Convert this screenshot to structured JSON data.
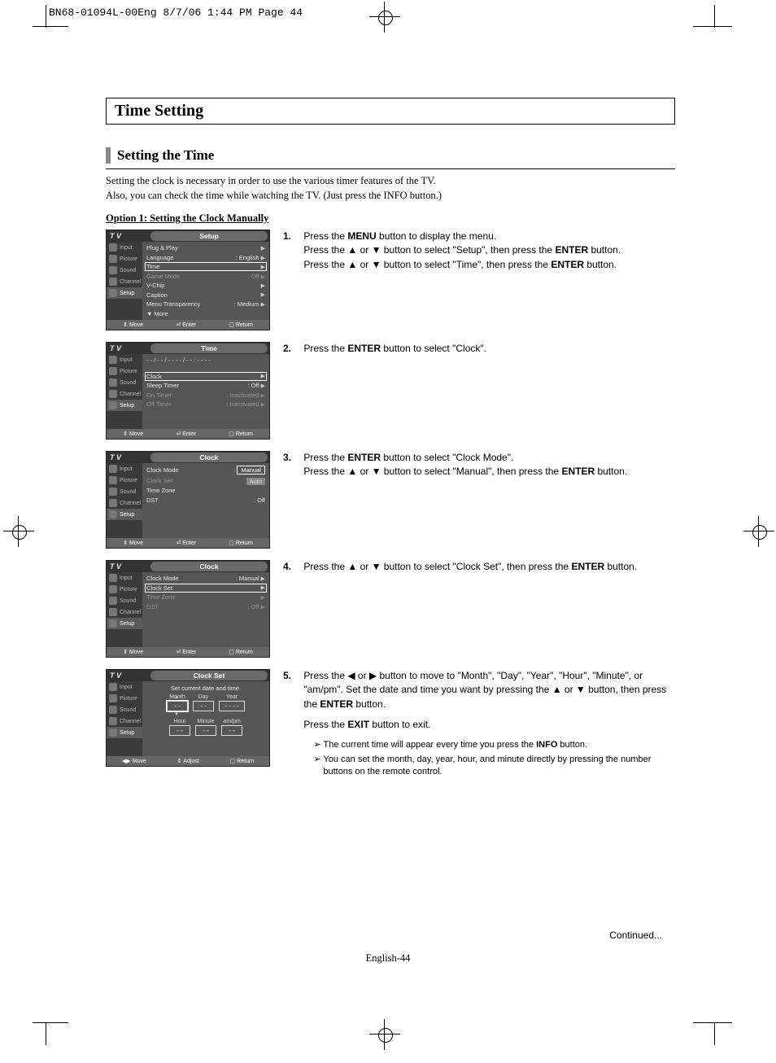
{
  "header": "BN68-01094L-00Eng  8/7/06  1:44 PM  Page 44",
  "section_title": "Time Setting",
  "subsection_title": "Setting the Time",
  "intro_line1": "Setting the clock is necessary in order to use the various timer features of the TV.",
  "intro_line2": "Also, you can check the time while watching the TV. (Just press the INFO button.)",
  "option_title": "Option 1: Setting the Clock Manually",
  "side": {
    "tv": "T V",
    "input": "Input",
    "picture": "Picture",
    "sound": "Sound",
    "channel": "Channel",
    "setup": "Setup"
  },
  "foot": {
    "move": "Move",
    "enter": "Enter",
    "return": "Return",
    "adjust": "Adjust"
  },
  "shot1": {
    "title": "Setup",
    "rows": [
      {
        "l": "Plug & Play",
        "r": ""
      },
      {
        "l": "Language",
        "r": ": English"
      },
      {
        "l": "Time",
        "r": "",
        "sel": true
      },
      {
        "l": "Game Mode",
        "r": ": Off",
        "dim": true
      },
      {
        "l": "V-Chip",
        "r": ""
      },
      {
        "l": "Caption",
        "r": ""
      },
      {
        "l": "Menu Transparency",
        "r": ": Medium"
      },
      {
        "l": "▼ More",
        "r": ""
      }
    ]
  },
  "shot2": {
    "title": "Time",
    "datetime": "- - / - - / - - - - /  - -  :  - -    - -",
    "rows": [
      {
        "l": "Clock",
        "r": "",
        "sel": true
      },
      {
        "l": "Sleep Timer",
        "r": ": Off"
      },
      {
        "l": "On Timer",
        "r": ": Inactivated",
        "dim": true
      },
      {
        "l": "Off Timer",
        "r": ": Inactivated",
        "dim": true
      }
    ]
  },
  "shot3": {
    "title": "Clock",
    "rows": [
      {
        "l": "Clock Mode",
        "r": "",
        "opts": [
          "Manual",
          "Auto"
        ]
      },
      {
        "l": "Clock Set",
        "r": "",
        "dim": true
      },
      {
        "l": "Time Zone",
        "r": ""
      },
      {
        "l": "DST",
        "r": ": Off"
      }
    ]
  },
  "shot4": {
    "title": "Clock",
    "rows": [
      {
        "l": "Clock Mode",
        "r": ": Manual"
      },
      {
        "l": "Clock Set",
        "r": "",
        "sel": true
      },
      {
        "l": "Time Zone",
        "r": "",
        "dim": true
      },
      {
        "l": "DST",
        "r": ": Off",
        "dim": true
      }
    ]
  },
  "shot5": {
    "title": "Clock Set",
    "subtitle": "Set current date and time.",
    "top_labels": [
      "Month",
      "Day",
      "Year"
    ],
    "top_vals": [
      "- -",
      "- -",
      "- - - -"
    ],
    "bot_labels": [
      "Hour",
      "Minute",
      "am/pm"
    ],
    "bot_vals": [
      "- -",
      "- -",
      "- -"
    ]
  },
  "steps": {
    "s1": {
      "n": "1.",
      "l1a": "Press the ",
      "l1b": "MENU",
      "l1c": " button to display the menu.",
      "l2": "Press the ▲ or ▼ button to select \"Setup\", then press the ",
      "l2b": "ENTER",
      "l2c": " button.",
      "l3": "Press the ▲ or ▼ button to select \"Time\", then press the ",
      "l3b": "ENTER",
      "l3c": " button."
    },
    "s2": {
      "n": "2.",
      "l1a": "Press the ",
      "l1b": "ENTER",
      "l1c": " button to select \"Clock\"."
    },
    "s3": {
      "n": "3.",
      "l1a": "Press the ",
      "l1b": "ENTER",
      "l1c": " button to select \"Clock  Mode\".",
      "l2": "Press the ▲ or ▼ button to select \"Manual\", then press the ",
      "l2b": "ENTER",
      "l2c": " button."
    },
    "s4": {
      "n": "4.",
      "l1": "Press the ▲ or ▼ button to select \"Clock Set\", then press the ",
      "l1b": "ENTER",
      "l1c": " button."
    },
    "s5": {
      "n": "5.",
      "p1": "Press the ◀ or ▶ button to move to \"Month\", \"Day\", \"Year\", \"Hour\", \"Minute\", or \"am/pm\". Set the date and time you want by pressing the ▲ or ▼ button, then press the ",
      "p1b": "ENTER",
      "p1c": " button.",
      "p2a": "Press the ",
      "p2b": "EXIT",
      "p2c": " button to exit.",
      "n1a": "The current time will appear every time you press the ",
      "n1b": "INFO",
      "n1c": " button.",
      "n2": "You can set the month, day, year, hour, and minute directly by pressing the number buttons on the remote control."
    }
  },
  "continued": "Continued...",
  "pagenum": "English-44"
}
